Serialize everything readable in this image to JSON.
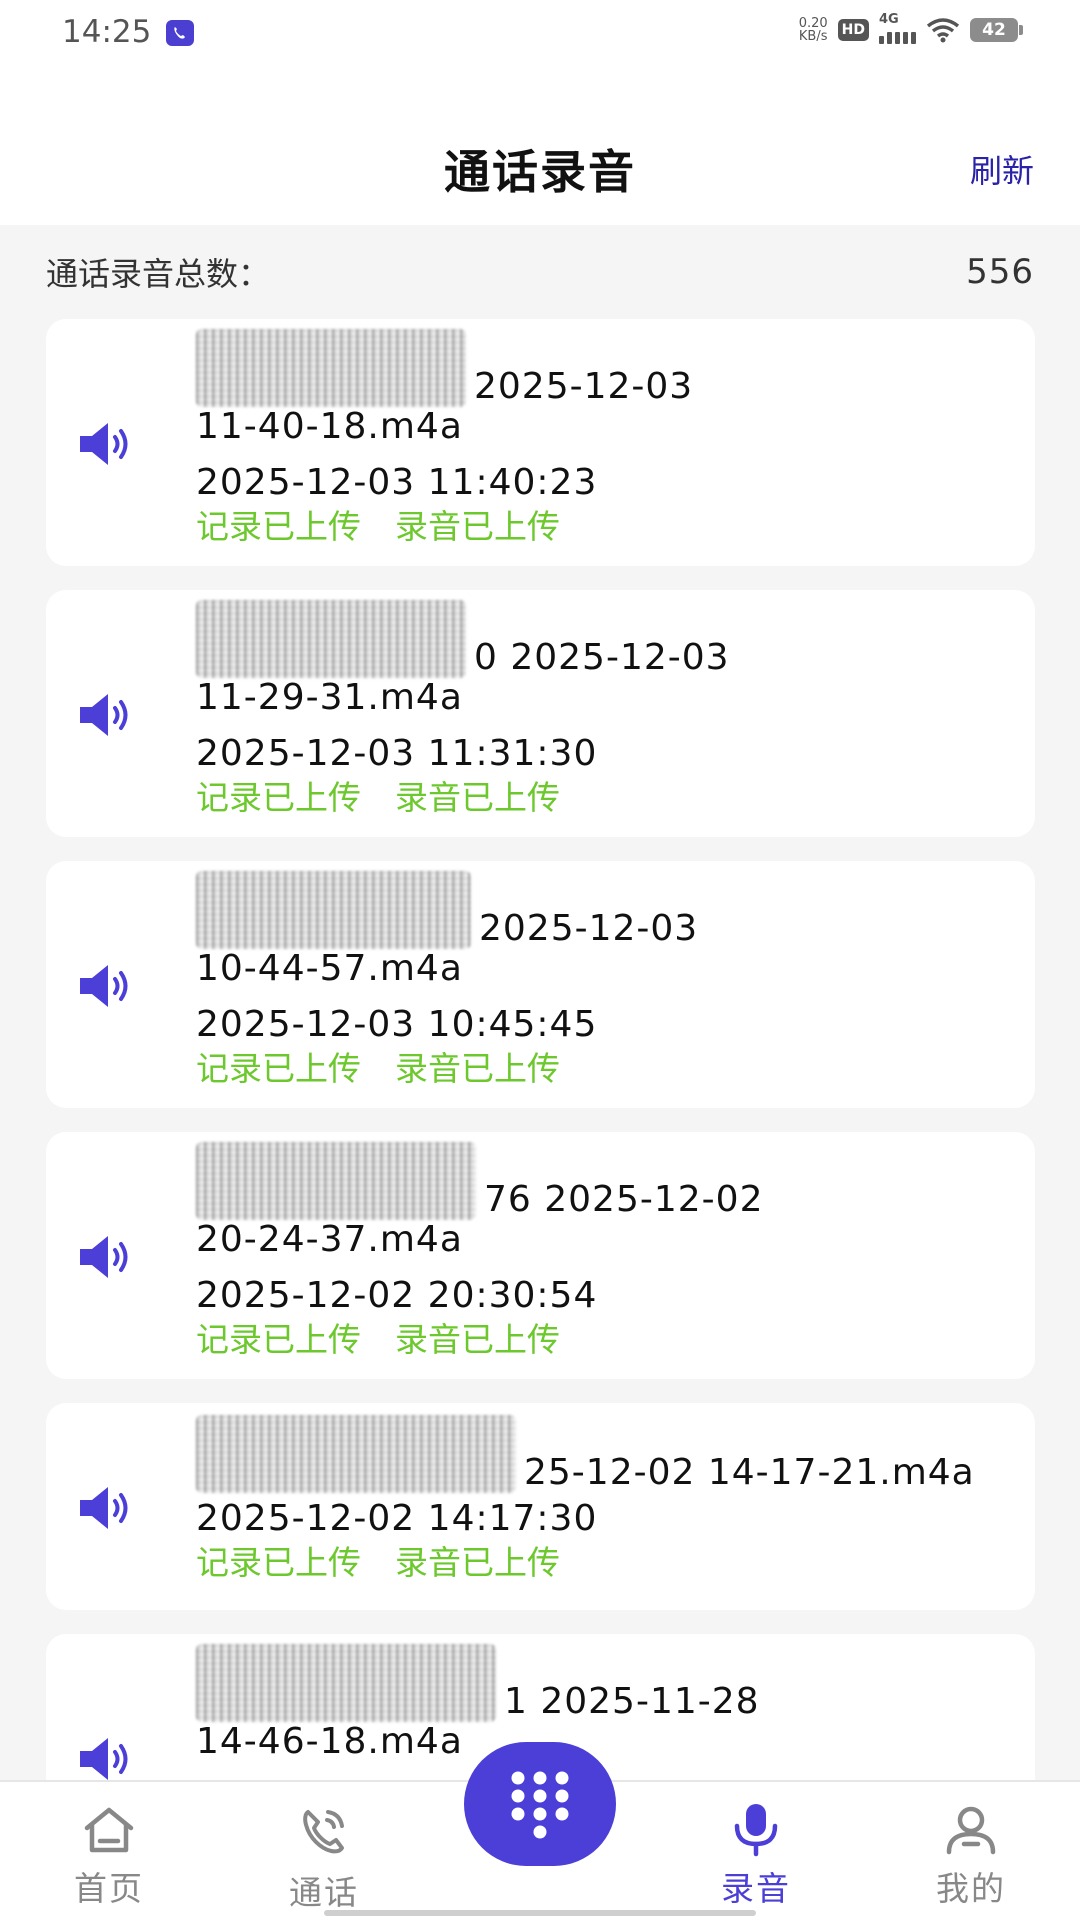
{
  "status_bar": {
    "time": "14:25",
    "net_speed_value": "0.20",
    "net_speed_unit": "KB/s",
    "hd": "HD",
    "network": "4G",
    "battery": "42"
  },
  "header": {
    "title": "通话录音",
    "refresh_label": "刷新"
  },
  "summary": {
    "total_label": "通话录音总数：",
    "total_value": "556"
  },
  "records": [
    {
      "file_name_line1": "2025-12-03",
      "file_name_line2": "11-40-18.m4a",
      "time": "2025-12-03 11:40:23",
      "record_status": "记录已上传",
      "audio_status": "录音已上传"
    },
    {
      "file_name_line1": "0 2025-12-03",
      "file_name_line2": "11-29-31.m4a",
      "time": "2025-12-03 11:31:30",
      "record_status": "记录已上传",
      "audio_status": "录音已上传"
    },
    {
      "file_name_line1": "2025-12-03",
      "file_name_line2": "10-44-57.m4a",
      "time": "2025-12-03 10:45:45",
      "record_status": "记录已上传",
      "audio_status": "录音已上传"
    },
    {
      "file_name_line1": "76 2025-12-02",
      "file_name_line2": "20-24-37.m4a",
      "time": "2025-12-02 20:30:54",
      "record_status": "记录已上传",
      "audio_status": "录音已上传"
    },
    {
      "file_name_line1": "25-12-02 14-17-21.m4a",
      "file_name_line2": "",
      "time": "2025-12-02 14:17:30",
      "record_status": "记录已上传",
      "audio_status": "录音已上传"
    },
    {
      "file_name_line1": "1 2025-11-28",
      "file_name_line2": "14-46-18.m4a",
      "time": "",
      "record_status": "",
      "audio_status": ""
    }
  ],
  "bottom_nav": {
    "home": "首页",
    "calls": "通话",
    "recordings": "录音",
    "mine": "我的",
    "active": "recordings"
  },
  "colors": {
    "accent": "#4b3fd8",
    "uploaded_status": "#6cc82c",
    "refresh": "#2a22a8"
  },
  "icons": {
    "speaker": "speaker-icon",
    "home": "home-icon",
    "calls": "phone-call-icon",
    "dialpad": "dialpad-icon",
    "recordings": "microphone-icon",
    "mine": "user-icon"
  }
}
